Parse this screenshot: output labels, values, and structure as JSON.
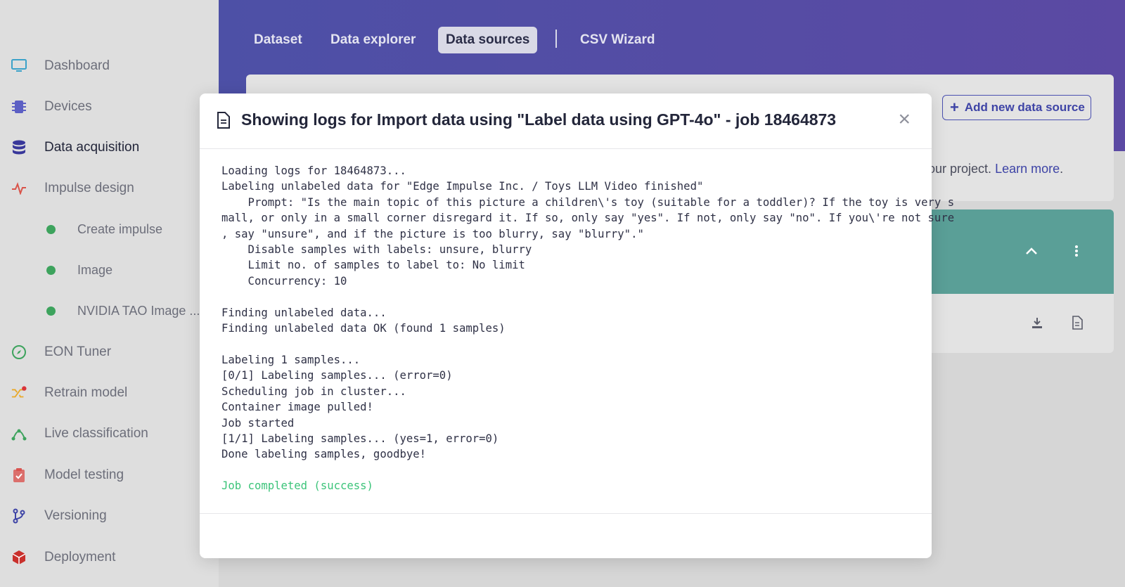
{
  "sidebar": {
    "items": [
      {
        "label": "Dashboard",
        "icon": "monitor-icon",
        "color": "#3ba2c9"
      },
      {
        "label": "Devices",
        "icon": "chip-icon",
        "color": "#5c5fc4"
      },
      {
        "label": "Data acquisition",
        "icon": "database-icon",
        "color": "#38379a"
      },
      {
        "label": "Impulse design",
        "icon": "pulse-icon",
        "color": "#d9544a"
      },
      {
        "label": "Create impulse",
        "icon": "dot-icon",
        "color": "#3da35d"
      },
      {
        "label": "Image",
        "icon": "dot-icon",
        "color": "#3da35d"
      },
      {
        "label": "NVIDIA TAO Image ...",
        "icon": "dot-icon",
        "color": "#3da35d"
      },
      {
        "label": "EON Tuner",
        "icon": "compass-icon",
        "color": "#3da35d"
      },
      {
        "label": "Retrain model",
        "icon": "shuffle-icon",
        "color": "#e9a826"
      },
      {
        "label": "Live classification",
        "icon": "nodes-icon",
        "color": "#3da35d"
      },
      {
        "label": "Model testing",
        "icon": "clipboard-check-icon",
        "color": "#d9534f"
      },
      {
        "label": "Versioning",
        "icon": "branch-icon",
        "color": "#3e44a6"
      },
      {
        "label": "Deployment",
        "icon": "box-icon",
        "color": "#c9302c"
      }
    ]
  },
  "tabs": {
    "dataset": "Dataset",
    "explorer": "Data explorer",
    "sources": "Data sources",
    "csv": "CSV Wizard"
  },
  "card": {
    "add_button": "Add new data source",
    "text_prefix": "our project.",
    "link": "Learn more",
    "period": "."
  },
  "modal": {
    "title": "Showing logs for Import data using \"Label data using GPT-4o\" - job 18464873",
    "close": "×",
    "log_lines": [
      "Loading logs for 18464873...",
      "Labeling unlabeled data for \"Edge Impulse Inc. / Toys LLM Video finished\"",
      "    Prompt: \"Is the main topic of this picture a children\\'s toy (suitable for a toddler)? If the toy is very s",
      "mall, or only in a small corner disregard it. If so, only say \"yes\". If not, only say \"no\". If you\\'re not sure",
      ", say \"unsure\", and if the picture is too blurry, say \"blurry\".\"",
      "    Disable samples with labels: unsure, blurry",
      "    Limit no. of samples to label to: No limit",
      "    Concurrency: 10",
      "",
      "Finding unlabeled data...",
      "Finding unlabeled data OK (found 1 samples)",
      "",
      "Labeling 1 samples...",
      "[0/1] Labeling samples... (error=0)",
      "Scheduling job in cluster...",
      "Container image pulled!",
      "Job started",
      "[1/1] Labeling samples... (yes=1, error=0)",
      "Done labeling samples, goodbye!",
      ""
    ],
    "final_line": "Job completed (success)"
  }
}
